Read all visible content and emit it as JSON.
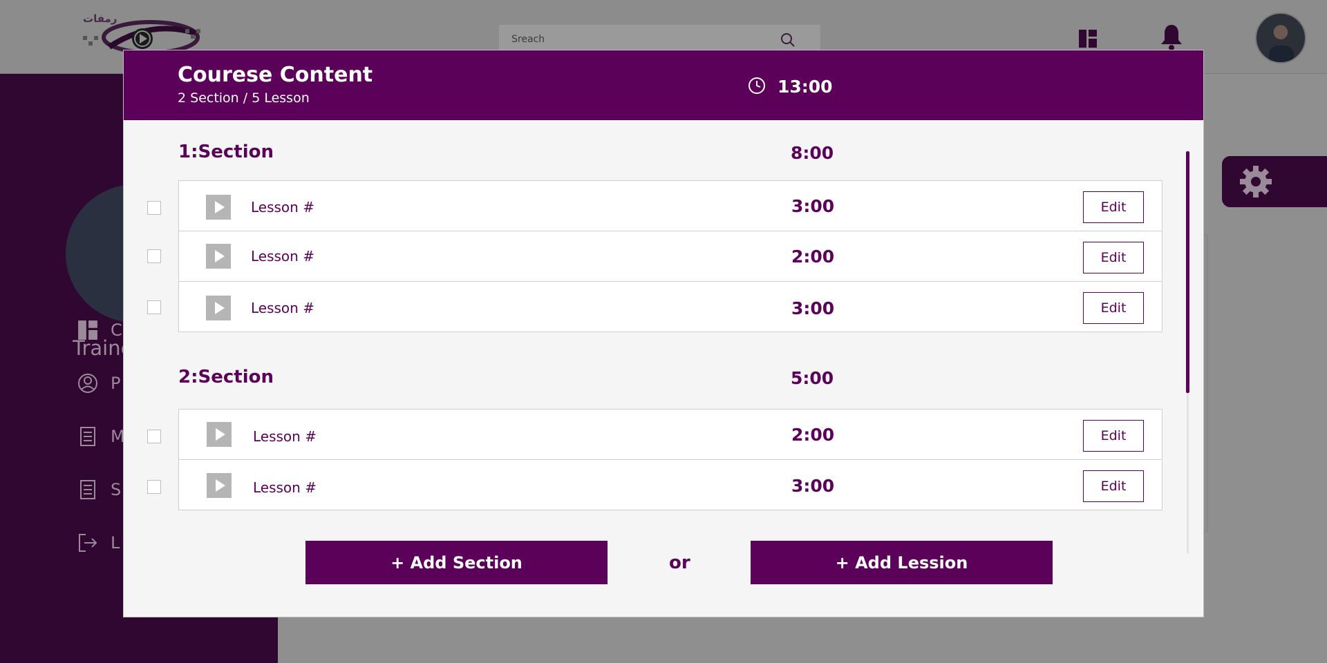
{
  "app": {
    "logo_text": "رمفات",
    "search": {
      "placeholder": "Sreach",
      "value": ""
    }
  },
  "sidebar": {
    "name": "Traine",
    "items": [
      {
        "label": "C",
        "icon": "dashboard-icon"
      },
      {
        "label": "P",
        "icon": "profile-icon"
      },
      {
        "label": "M",
        "icon": "document-list-icon"
      },
      {
        "label": "S",
        "icon": "document-list-icon"
      },
      {
        "label": "L",
        "icon": "logout-icon"
      }
    ]
  },
  "modal": {
    "title": "Courese Content",
    "subtitle": "2 Section / 5 Lesson",
    "total_time": "13:00",
    "sections": [
      {
        "title": "1:Section",
        "time": "8:00",
        "lessons": [
          {
            "name": "Lesson #",
            "time": "3:00",
            "edit_label": "Edit"
          },
          {
            "name": "Lesson #",
            "time": "2:00",
            "edit_label": "Edit"
          },
          {
            "name": "Lesson #",
            "time": "3:00",
            "edit_label": "Edit"
          }
        ]
      },
      {
        "title": "2:Section",
        "time": "5:00",
        "lessons": [
          {
            "name": "Lesson #",
            "time": "2:00",
            "edit_label": "Edit"
          },
          {
            "name": "Lesson #",
            "time": "3:00",
            "edit_label": "Edit"
          }
        ]
      }
    ],
    "add_section_label": "+ Add Section",
    "or_label": "or",
    "add_lesson_label": "+ Add Lession"
  },
  "colors": {
    "brand": "#5c0159",
    "overlay": "#8f8f8f",
    "modal_bg": "#f5f5f5",
    "play_button": "#b5b5b5"
  }
}
